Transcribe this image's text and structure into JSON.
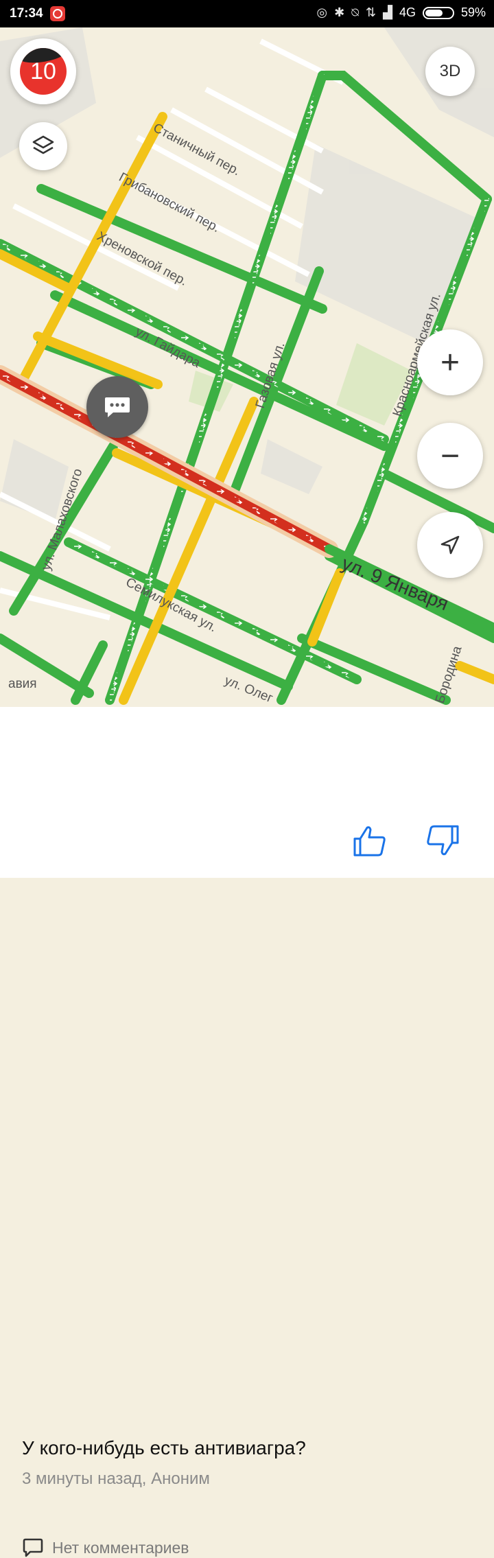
{
  "status": {
    "time": "17:34",
    "network": "4G",
    "battery": "59%"
  },
  "map": {
    "traffic_level": "10",
    "mode_3d_label": "3D",
    "zoom_in_label": "+",
    "zoom_out_label": "−",
    "streets": [
      "Станичный пер.",
      "Грибановский пер.",
      "Хреновской пер.",
      "ул. Гайдара",
      "Газовая ул.",
      "Красноармейская ул.",
      "ул. Малаховского",
      "ул. 9 Января",
      "Семилукская ул.",
      "ул. Олег",
      "Бородина",
      "авия"
    ]
  },
  "post": {
    "text": "У кого-нибудь есть антивиагра?",
    "meta": "3 минуты назад, Аноним",
    "comments": "Нет комментариев"
  },
  "colors": {
    "free": "#3cb043",
    "slow": "#f2c318",
    "jam": "#d32f1e",
    "accent": "#1a73e8"
  }
}
